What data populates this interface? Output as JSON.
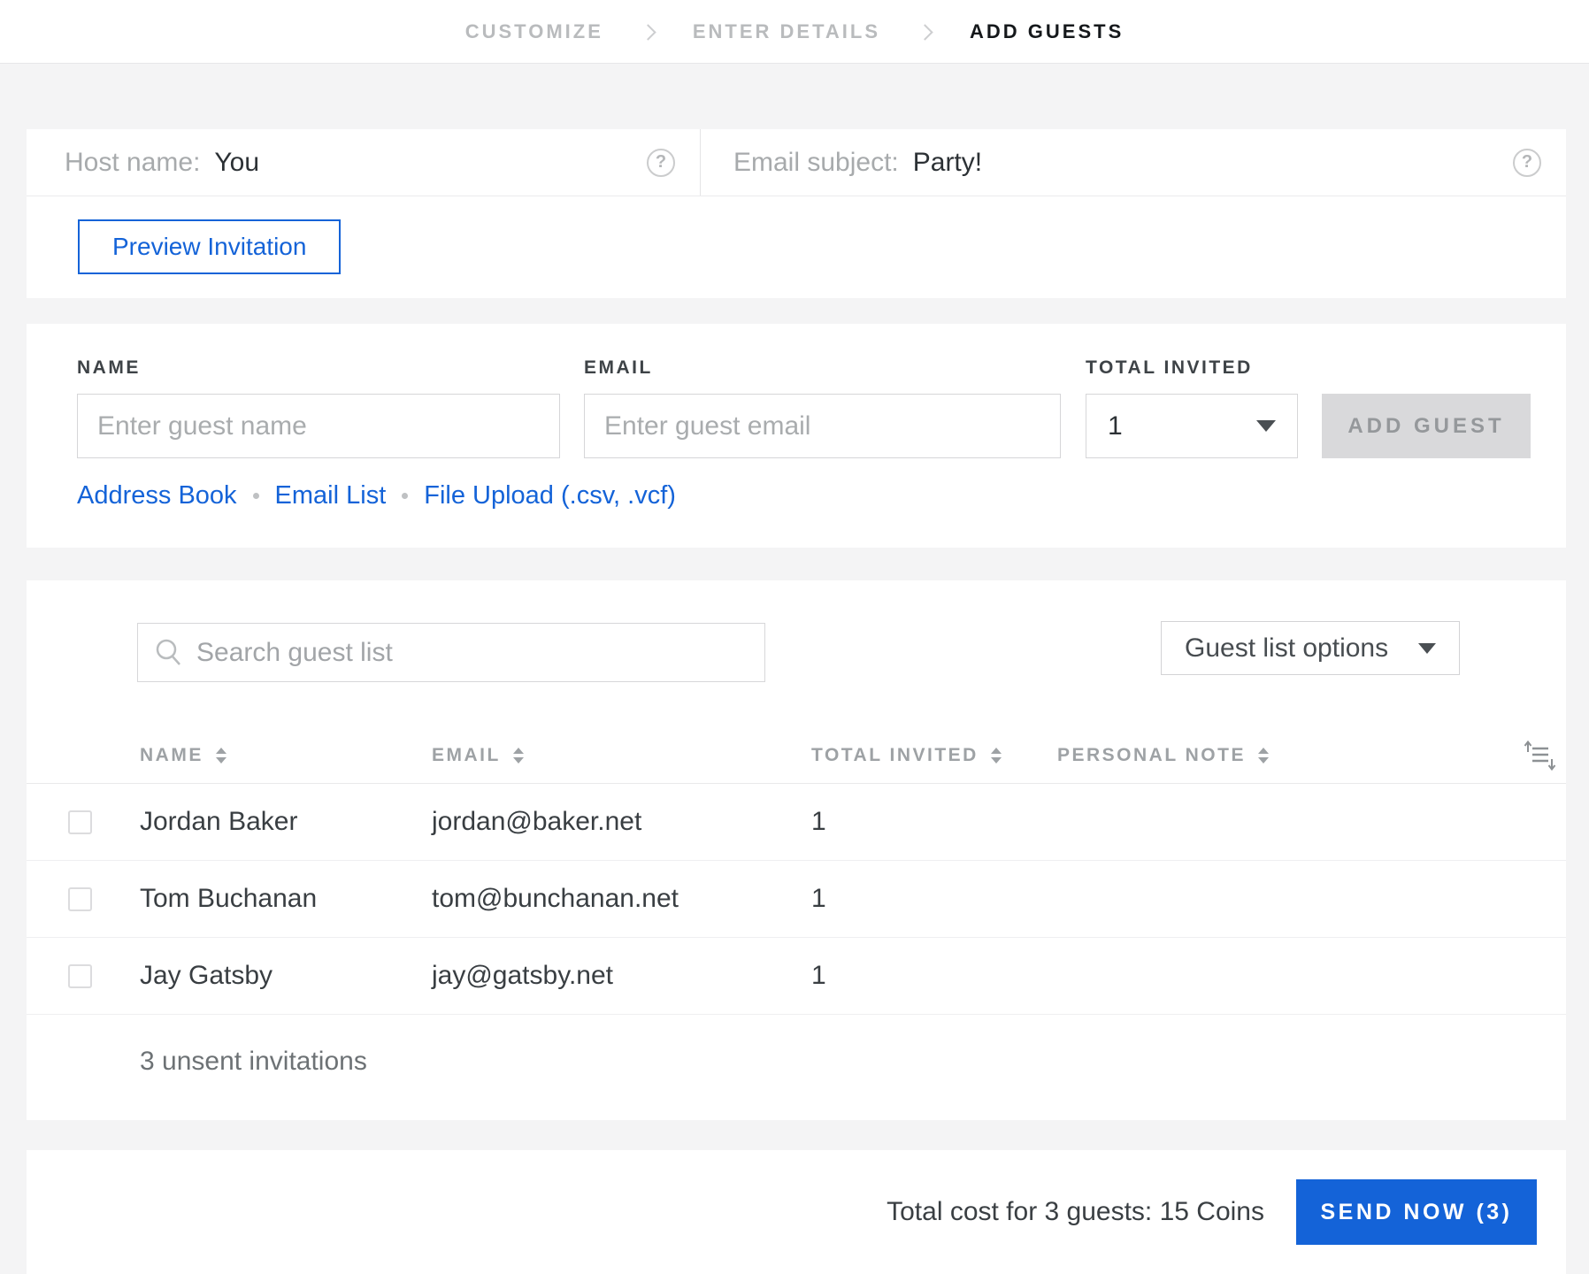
{
  "breadcrumb": {
    "steps": [
      {
        "label": "CUSTOMIZE",
        "active": false
      },
      {
        "label": "ENTER DETAILS",
        "active": false
      },
      {
        "label": "ADD GUESTS",
        "active": true
      }
    ]
  },
  "details": {
    "host_label": "Host name:",
    "host_value": "You",
    "subject_label": "Email subject:",
    "subject_value": "Party!",
    "preview_button": "Preview Invitation"
  },
  "add_guest_form": {
    "name_label": "NAME",
    "name_placeholder": "Enter guest name",
    "email_label": "EMAIL",
    "email_placeholder": "Enter guest email",
    "total_invited_label": "TOTAL INVITED",
    "total_invited_value": "1",
    "add_button": "ADD GUEST",
    "links": {
      "address_book": "Address Book",
      "email_list": "Email List",
      "file_upload": "File Upload (.csv, .vcf)"
    }
  },
  "guest_list": {
    "search_placeholder": "Search guest list",
    "options_button": "Guest list options",
    "columns": [
      "NAME",
      "EMAIL",
      "TOTAL INVITED",
      "PERSONAL NOTE"
    ],
    "rows": [
      {
        "name": "Jordan Baker",
        "email": "jordan@baker.net",
        "total_invited": "1",
        "personal_note": ""
      },
      {
        "name": "Tom Buchanan",
        "email": "tom@bunchanan.net",
        "total_invited": "1",
        "personal_note": ""
      },
      {
        "name": "Jay Gatsby",
        "email": "jay@gatsby.net",
        "total_invited": "1",
        "personal_note": ""
      }
    ],
    "unsent_note": "3 unsent invitations"
  },
  "footer": {
    "total_cost_text": "Total cost for 3 guests: 15 Coins",
    "send_button": "SEND NOW (3)"
  },
  "colors": {
    "accent_blue": "#1463d8",
    "page_bg": "#f4f4f5",
    "disabled_button_bg": "#d9d9db"
  },
  "icons": {
    "help": "?",
    "chevron_right": "›",
    "caret_down": "▾",
    "search": "magnifier",
    "column_sort": "up-down triangles",
    "reorder": "list with up/down arrows"
  }
}
